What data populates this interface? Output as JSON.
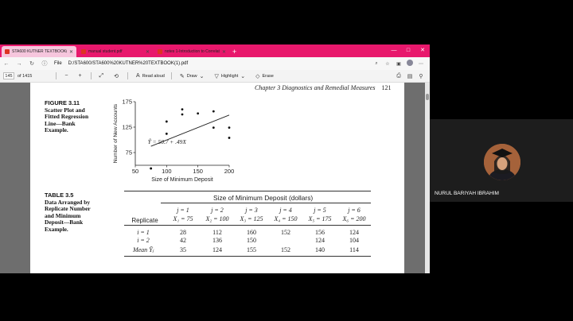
{
  "browser": {
    "tabs": [
      {
        "label": "STA600 KUTNER TEXTBOOK(1).p",
        "active": true
      },
      {
        "label": "manual student.pdf",
        "active": false
      },
      {
        "label": "notes 1-Introduction to Correlat",
        "active": false
      }
    ],
    "new_tab": "+",
    "window_controls": {
      "minimize": "—",
      "maximize": "□",
      "close": "✕"
    },
    "file_label": "File",
    "url": "D:/STA600/STA600%20KUTNER%20TEXTBOOK(1).pdf"
  },
  "pdf_toolbar": {
    "page_current": "145",
    "page_total": "of 1415",
    "read_aloud": "Read aloud",
    "draw": "Draw",
    "highlight": "Highlight",
    "erase": "Erase"
  },
  "page": {
    "running_head": "Chapter 3   Diagnostics and Remedial Measures",
    "page_number": "121",
    "figure_caption": {
      "number": "FIGURE 3.11",
      "text": "Scatter Plot and Fitted Regression Line—Bank Example."
    },
    "table_caption": {
      "number": "TABLE 3.5",
      "text": "Data Arranged by Replicate Number and Minimum Deposit—Bank Example."
    },
    "table": {
      "title": "Size of Minimum Deposit (dollars)",
      "replicate_header": "Replicate",
      "columns": [
        {
          "j": "j = 1",
          "x": "X₁ = 75"
        },
        {
          "j": "j = 2",
          "x": "X₂ = 100"
        },
        {
          "j": "j = 3",
          "x": "X₃ = 125"
        },
        {
          "j": "j = 4",
          "x": "X₄ = 150"
        },
        {
          "j": "j = 5",
          "x": "X₅ = 175"
        },
        {
          "j": "j = 6",
          "x": "X₆ = 200"
        }
      ],
      "rows": [
        {
          "label": "i = 1",
          "values": [
            "28",
            "112",
            "160",
            "152",
            "156",
            "124"
          ]
        },
        {
          "label": "i = 2",
          "values": [
            "42",
            "136",
            "150",
            "",
            "124",
            "104"
          ]
        },
        {
          "label": "Mean Ȳⱼ",
          "values": [
            "35",
            "124",
            "155",
            "152",
            "140",
            "114"
          ]
        }
      ]
    }
  },
  "chart_data": {
    "type": "scatter",
    "ylabel": "Number of New Accounts",
    "xlabel": "Size of Minimum Deposit",
    "x_ticks": [
      "50",
      "100",
      "150",
      "200"
    ],
    "y_ticks": [
      "75",
      "125",
      "175"
    ],
    "xlim": [
      50,
      200
    ],
    "ylim": [
      50,
      175
    ],
    "annotation": "Ŷ = 50.7 + .49X",
    "fitted_line": {
      "intercept": 50.7,
      "slope": 0.49,
      "x_range": [
        75,
        200
      ]
    },
    "points": [
      {
        "x": 75,
        "y": 28
      },
      {
        "x": 75,
        "y": 42
      },
      {
        "x": 100,
        "y": 112
      },
      {
        "x": 100,
        "y": 136
      },
      {
        "x": 125,
        "y": 160
      },
      {
        "x": 125,
        "y": 150
      },
      {
        "x": 150,
        "y": 152
      },
      {
        "x": 175,
        "y": 156
      },
      {
        "x": 175,
        "y": 124
      },
      {
        "x": 200,
        "y": 124
      },
      {
        "x": 200,
        "y": 104
      }
    ]
  },
  "participant": {
    "name": "NURUL BARIYAH IBRAHIM"
  }
}
